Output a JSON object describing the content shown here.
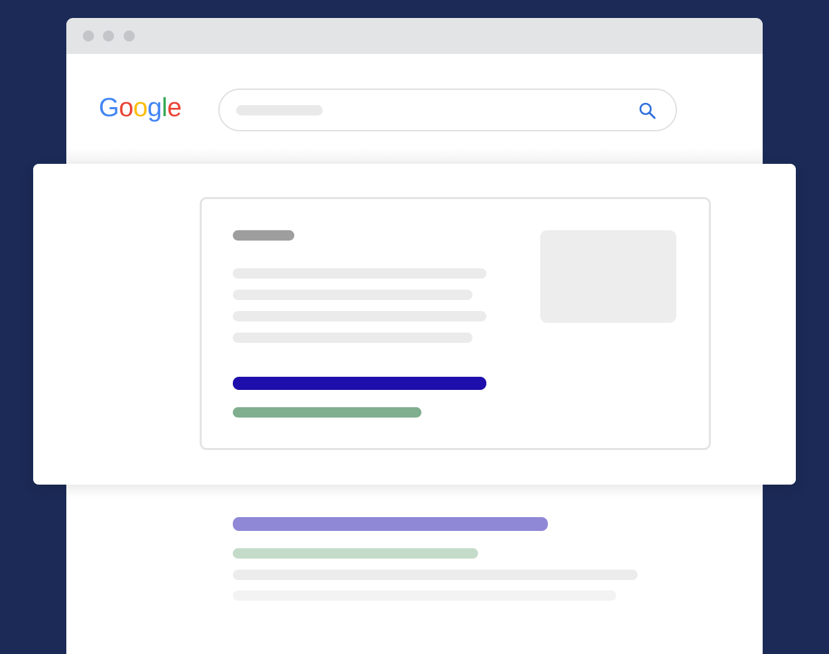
{
  "browser": {
    "window_controls": [
      "close",
      "minimize",
      "maximize"
    ]
  },
  "search_page": {
    "logo": {
      "letters": [
        {
          "char": "G",
          "color": "#4285F4"
        },
        {
          "char": "o",
          "color": "#EA4335"
        },
        {
          "char": "o",
          "color": "#FBBC05"
        },
        {
          "char": "g",
          "color": "#4285F4"
        },
        {
          "char": "l",
          "color": "#34A853"
        },
        {
          "char": "e",
          "color": "#EA4335"
        }
      ]
    },
    "search_box": {
      "icon": "search-icon",
      "icon_color": "#2e6fdb"
    }
  },
  "featured_snippet": {
    "accent_colors": {
      "title_bar": "#9e9e9e",
      "text_lines": "#ebebeb",
      "link": "#1e0eab",
      "url": "#7faf8f",
      "image": "#ededed"
    }
  },
  "results": {
    "accent_colors": {
      "link": "#8f88d6",
      "url": "#c4dbca",
      "text_lines": [
        "#ececec",
        "#f3f3f3"
      ]
    }
  }
}
